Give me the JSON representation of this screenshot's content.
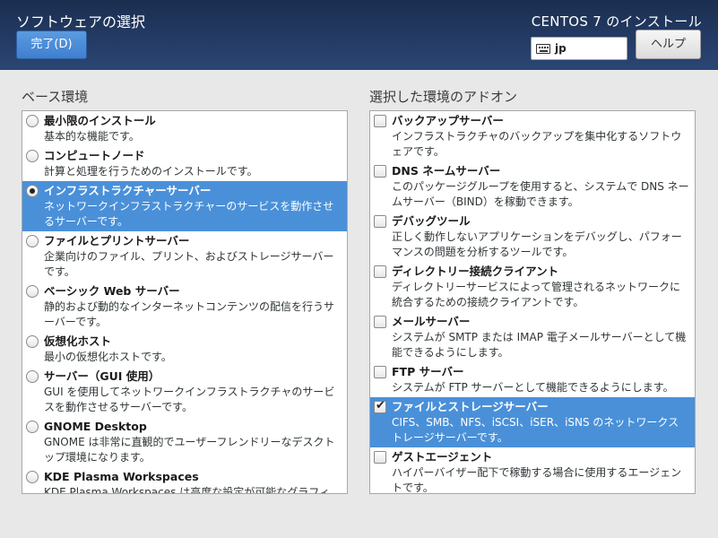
{
  "header": {
    "title": "ソフトウェアの選択",
    "done_label": "完了(D)",
    "product": "CENTOS 7 のインストール",
    "keyboard": "jp",
    "help_label": "ヘルプ"
  },
  "base": {
    "heading": "ベース環境",
    "items": [
      {
        "title": "最小限のインストール",
        "desc": "基本的な機能です。"
      },
      {
        "title": "コンピュートノード",
        "desc": "計算と処理を行うためのインストールです。"
      },
      {
        "title": "インフラストラクチャーサーバー",
        "desc": "ネットワークインフラストラクチャーのサービスを動作させるサーバーです。"
      },
      {
        "title": "ファイルとプリントサーバー",
        "desc": "企業向けのファイル、プリント、およびストレージサーバーです。"
      },
      {
        "title": "ベーシック Web サーバー",
        "desc": "静的および動的なインターネットコンテンツの配信を行うサーバーです。"
      },
      {
        "title": "仮想化ホスト",
        "desc": "最小の仮想化ホストです。"
      },
      {
        "title": "サーバー（GUI 使用）",
        "desc": "GUI を使用してネットワークインフラストラクチャのサービスを動作させるサーバーです。"
      },
      {
        "title": "GNOME Desktop",
        "desc": "GNOME は非常に直観的でユーザーフレンドリーなデスクトップ環境になります。"
      },
      {
        "title": "KDE Plasma Workspaces",
        "desc": "KDE Plasma Workspaces は高度な設定が可能なグラフィ"
      }
    ]
  },
  "addons": {
    "heading": "選択した環境のアドオン",
    "items": [
      {
        "title": "バックアップサーバー",
        "desc": "インフラストラクチャのバックアップを集中化するソフトウェアです。"
      },
      {
        "title": "DNS ネームサーバー",
        "desc": "このパッケージグループを使用すると、システムで DNS ネームサーバー（BIND）を稼動できます。"
      },
      {
        "title": "デバッグツール",
        "desc": "正しく動作しないアプリケーションをデバッグし、パフォーマンスの問題を分析するツールです。"
      },
      {
        "title": "ディレクトリー接続クライアント",
        "desc": "ディレクトリーサービスによって管理されるネットワークに統合するための接続クライアントです。"
      },
      {
        "title": "メールサーバー",
        "desc": "システムが SMTP または IMAP 電子メールサーバーとして機能できるようにします。"
      },
      {
        "title": "FTP サーバー",
        "desc": "システムが FTP サーバーとして機能できるようにします。"
      },
      {
        "title": "ファイルとストレージサーバー",
        "desc": "CIFS、SMB、NFS、iSCSI、iSER、iSNS のネットワークストレージサーバーです。"
      },
      {
        "title": "ゲストエージェント",
        "desc": "ハイパーバイザー配下で稼動する場合に使用するエージェントです。"
      }
    ]
  }
}
